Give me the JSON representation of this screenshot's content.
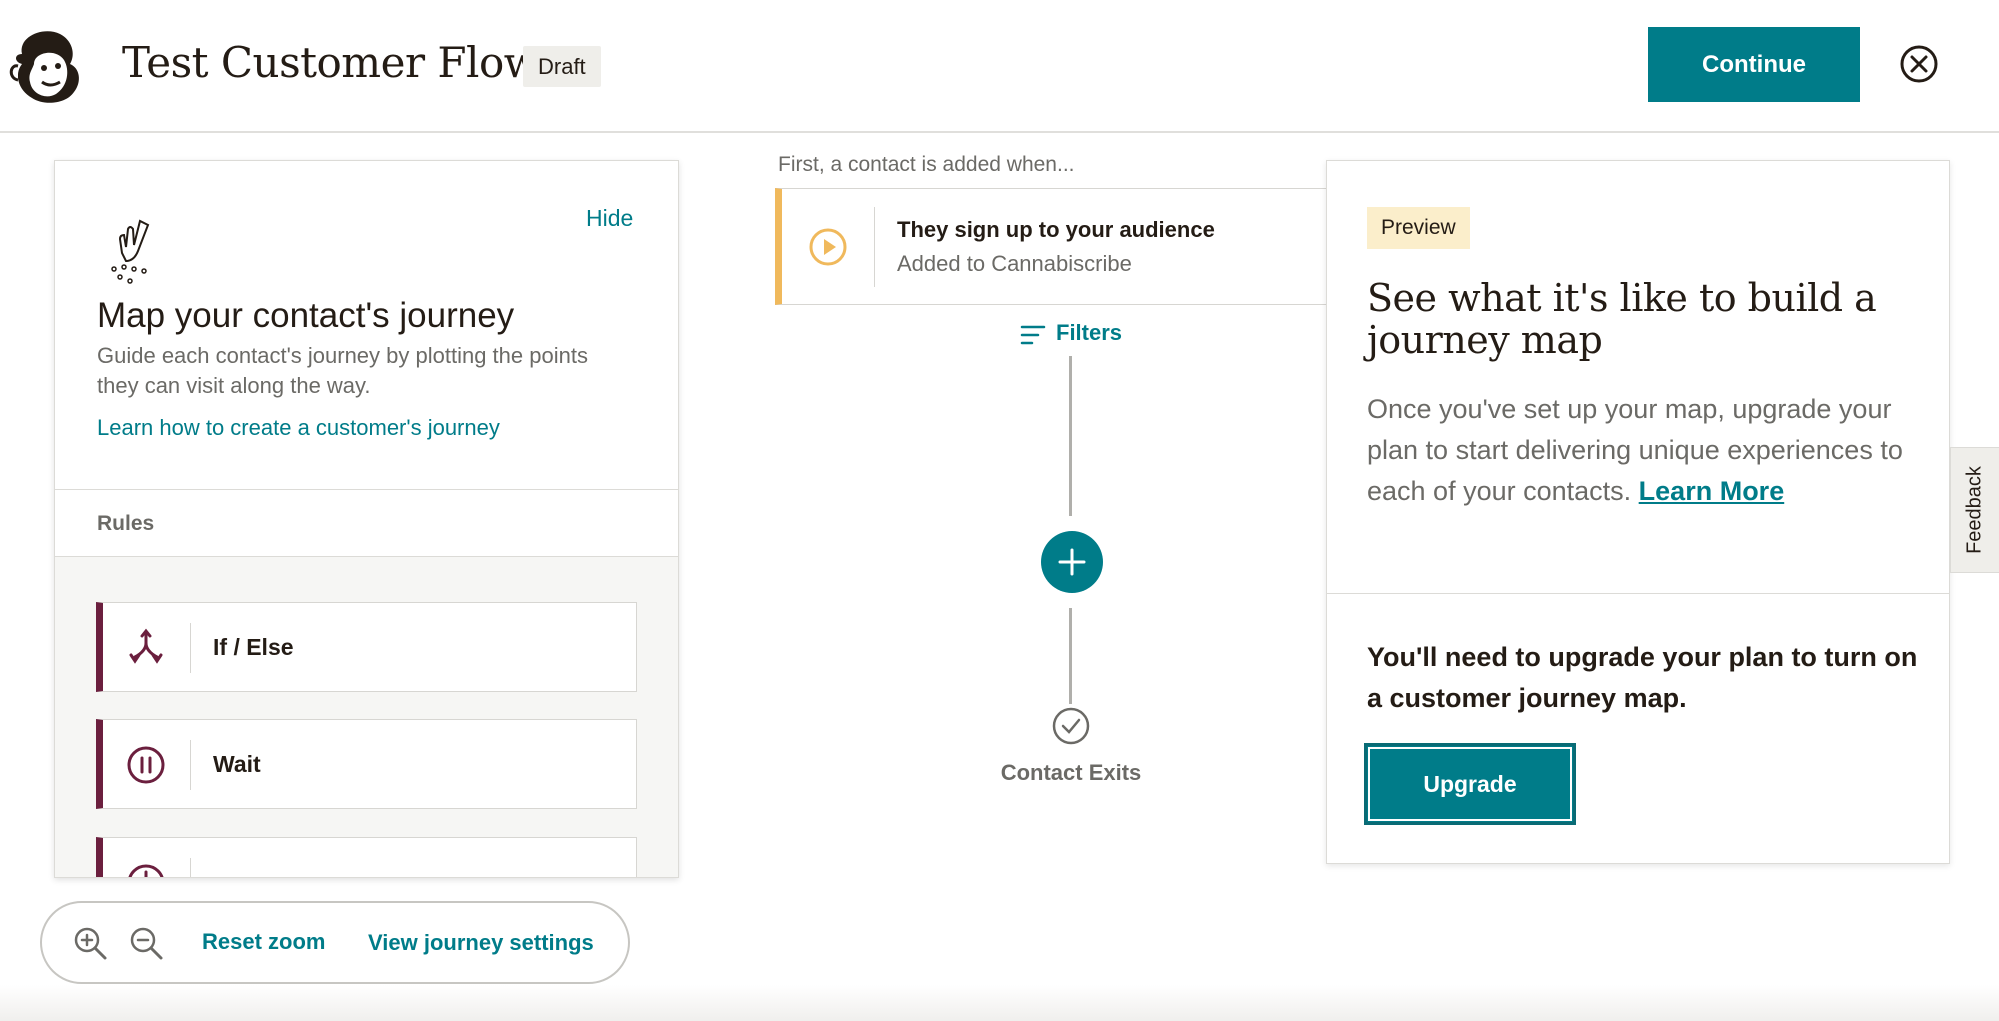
{
  "header": {
    "title": "Test Customer Flow",
    "status_badge": "Draft",
    "continue_label": "Continue"
  },
  "left_panel": {
    "hide_label": "Hide",
    "heading": "Map your contact's journey",
    "description": "Guide each contact's journey by plotting the points they can visit along the way.",
    "learn_link": "Learn how to create a customer's journey",
    "rules_label": "Rules",
    "rules": [
      {
        "label": "If / Else",
        "icon": "split-arrows-icon"
      },
      {
        "label": "Wait",
        "icon": "pause-circle-icon"
      },
      {
        "label": "",
        "icon": "clock-icon"
      }
    ]
  },
  "zoom_bar": {
    "reset_zoom_label": "Reset zoom",
    "view_settings_label": "View journey settings"
  },
  "canvas": {
    "first_label": "First, a contact is added when...",
    "trigger_title": "They sign up to your audience",
    "trigger_subtitle": "Added to Cannabiscribe",
    "filters_label": "Filters",
    "exit_label": "Contact Exits"
  },
  "right_panel": {
    "badge": "Preview",
    "heading": "See what it's like to build a journey map",
    "body": "Once you've set up your map, upgrade your plan to start delivering unique experiences to each of your contacts.",
    "learn_more": "Learn More",
    "upgrade_text": "You'll need to upgrade your plan to turn on a customer journey map.",
    "upgrade_label": "Upgrade"
  },
  "feedback_label": "Feedback",
  "colors": {
    "brand_teal": "#007c89",
    "rule_accent": "#6b1f3e",
    "trigger_accent": "#f0b95c",
    "preview_badge_bg": "#fbeecb"
  }
}
